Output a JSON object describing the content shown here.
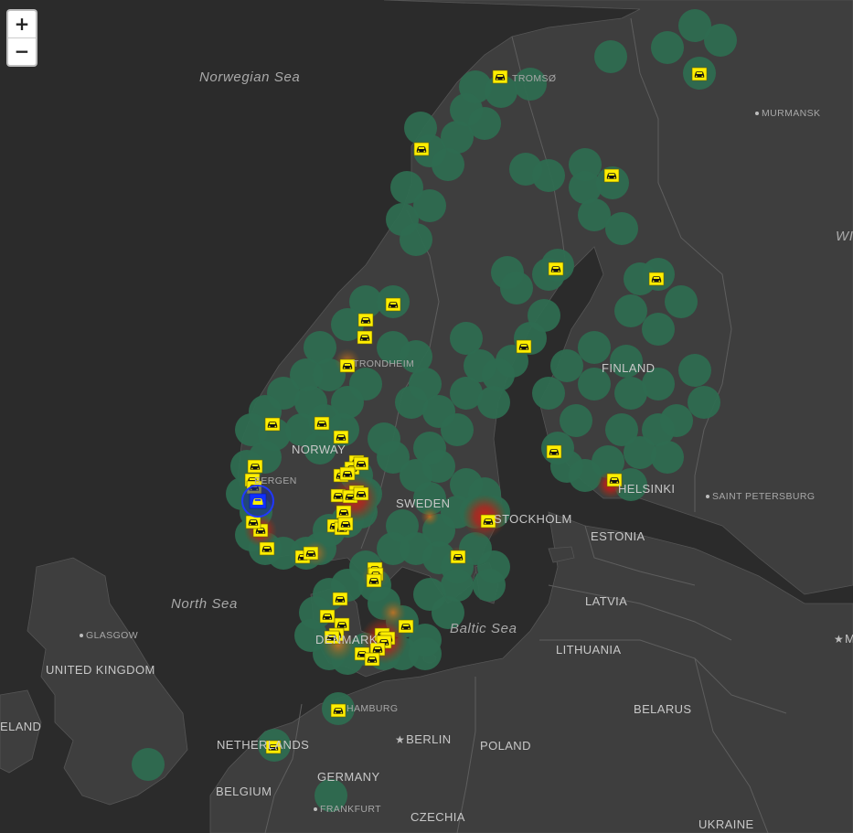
{
  "zoom_controls": {
    "zoom_in": "+",
    "zoom_out": "−"
  },
  "labels": {
    "seas": {
      "norwegian_sea": "Norwegian Sea",
      "north_sea": "North Sea",
      "baltic_sea": "Baltic Sea"
    },
    "countries": {
      "norway": "NORWAY",
      "sweden": "SWEDEN",
      "finland": "FINLAND",
      "estonia": "ESTONIA",
      "latvia": "LATVIA",
      "lithuania": "LITHUANIA",
      "belarus": "BELARUS",
      "poland": "POLAND",
      "germany": "GERMANY",
      "netherlands": "NETHERLANDS",
      "belgium": "BELGIUM",
      "czechia": "CZECHIA",
      "ukraine": "UKRAINE",
      "united_kingdom": "UNITED KINGDOM",
      "denmark": "DENMARK",
      "ireland_partial": "ELAND",
      "russia_partial": "WI"
    },
    "cities": {
      "tromso": "TROMSØ",
      "murmansk": "MURMANSK",
      "trondheim": "TRONDHEIM",
      "bergen": "BERGEN",
      "stockholm": "STOCKHOLM",
      "helsinki": "HELSINKI",
      "saint_petersburg": "SAINT PETERSBURG",
      "glasgow": "GLASGOW",
      "hamburg": "HAMBURG",
      "berlin": "BERLIN",
      "frankfurt": "FRANKFURT",
      "moscow_partial": "M"
    }
  },
  "layers": {
    "coverage": {
      "name": "coverage-circles",
      "color": "#2e6b50"
    },
    "heat": {
      "name": "heatmap",
      "colors": [
        "#c9201c",
        "#d0661e",
        "#b8862a"
      ]
    },
    "markers": {
      "name": "car-markers",
      "icon": "car-icon",
      "color": "#ffee00",
      "count": 79
    },
    "selected_marker": {
      "icon": "car-icon",
      "color": "#1030ff"
    }
  },
  "colors": {
    "background": "#2b2b2b",
    "land": "#3e3e3e",
    "borders": "#5d5d5d"
  }
}
